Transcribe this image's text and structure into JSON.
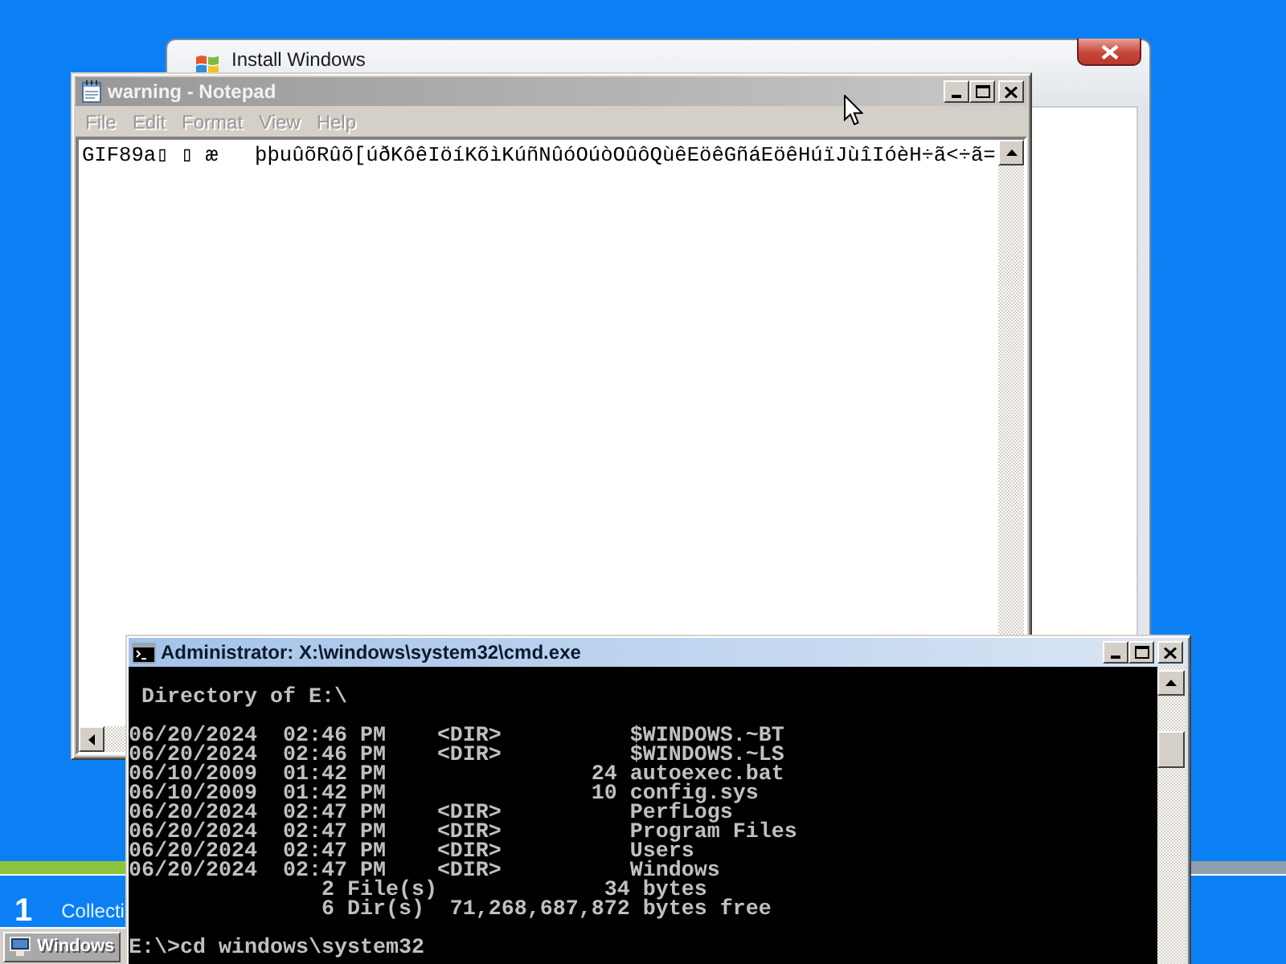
{
  "install_window": {
    "title": "Install Windows"
  },
  "notepad": {
    "title": "warning - Notepad",
    "active": false,
    "menu": [
      {
        "label": "File",
        "disabled": true
      },
      {
        "label": "Edit",
        "disabled": true
      },
      {
        "label": "Format",
        "disabled": true
      },
      {
        "label": "View",
        "disabled": true
      },
      {
        "label": "Help",
        "disabled": true
      }
    ],
    "text": "GIF89a▯ ▯ æ   þþuûõRûõ[úðKôêIöíKõìKúñNûóOúòOûôQùêEöêGñáEöêHúïJùîIóèH÷ã<÷ã="
  },
  "console": {
    "title": "Administrator: X:\\windows\\system32\\cmd.exe",
    "active": true,
    "heading": "Directory of E:\\",
    "entries": [
      {
        "date": "06/20/2024",
        "time": "02:46 PM",
        "dir": "<DIR>",
        "name": "$WINDOWS.~BT"
      },
      {
        "date": "06/20/2024",
        "time": "02:46 PM",
        "dir": "<DIR>",
        "name": "$WINDOWS.~LS"
      },
      {
        "date": "06/10/2009",
        "time": "01:42 PM",
        "size": "24",
        "name": "autoexec.bat"
      },
      {
        "date": "06/10/2009",
        "time": "01:42 PM",
        "size": "10",
        "name": "config.sys"
      },
      {
        "date": "06/20/2024",
        "time": "02:47 PM",
        "dir": "<DIR>",
        "name": "PerfLogs"
      },
      {
        "date": "06/20/2024",
        "time": "02:47 PM",
        "dir": "<DIR>",
        "name": "Program Files"
      },
      {
        "date": "06/20/2024",
        "time": "02:47 PM",
        "dir": "<DIR>",
        "name": "Users"
      },
      {
        "date": "06/20/2024",
        "time": "02:47 PM",
        "dir": "<DIR>",
        "name": "Windows"
      }
    ],
    "summary": [
      {
        "count": "2",
        "label": "File(s)",
        "amount": "34",
        "unit": "bytes"
      },
      {
        "count": "6",
        "label": "Dir(s)",
        "amount": "71,268,687,872",
        "unit": "bytes free"
      }
    ],
    "prompt": "E:\\>cd windows\\system32"
  },
  "setup": {
    "step": {
      "number": "1",
      "label": "Collecti"
    }
  },
  "taskbar": {
    "buttons": [
      {
        "label": "Windows"
      }
    ]
  }
}
